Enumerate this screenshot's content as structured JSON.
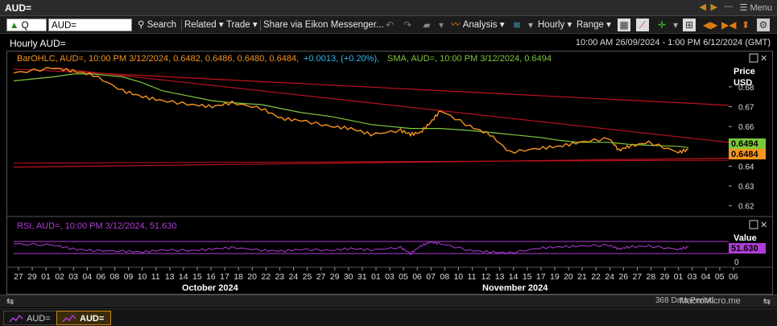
{
  "window": {
    "title": "AUD=",
    "menu_label": "Menu"
  },
  "toolbar": {
    "quote_label": "Q",
    "ric_value": "AUD=",
    "search_label": "Search",
    "related_label": "Related",
    "trade_label": "Trade",
    "share_label": "Share via Eikon Messenger...",
    "analysis_label": "Analysis",
    "interval_label": "Hourly",
    "range_label": "Range"
  },
  "header": {
    "chart_title": "Hourly AUD=",
    "time_range": "10:00 AM 26/09/2024 - 1:00 PM 6/12/2024 (GMT)"
  },
  "price_panel": {
    "legend_barohlc": "BarOHLC, AUD=, 10:00 PM 3/12/2024, 0.6482, 0.6486, 0.6480, 0.6484,",
    "legend_change": "+0.0013, (+0.20%),",
    "legend_sma": "SMA, AUD=, 10:00 PM 3/12/2024, 0.6494",
    "axis_title": "Price",
    "axis_unit": "USD",
    "y_ticks": [
      "0.68",
      "0.67",
      "0.66",
      "0.65",
      "0.64",
      "0.63",
      "0.62"
    ],
    "sma_badge": "0.6494",
    "price_badge": "0.6484",
    "colors": {
      "price": "#f7941d",
      "sma": "#7dc83a",
      "trendline": "#c0121d",
      "sma_badge_bg": "#7dc83a",
      "price_badge_bg": "#f7941d"
    }
  },
  "rsi_panel": {
    "legend": "RSI, AUD=, 10:00 PM 3/12/2024, 51.630",
    "axis_title": "Value",
    "value_badge": "51.630",
    "y_tick": "0",
    "colors": {
      "rsi": "#b03cd8",
      "band": "#b03cd8",
      "badge_bg": "#b03cd8"
    }
  },
  "x_axis": {
    "ticks": [
      "27",
      "29",
      "01",
      "02",
      "03",
      "04",
      "06",
      "08",
      "09",
      "10",
      "11",
      "13",
      "14",
      "15",
      "16",
      "17",
      "18",
      "20",
      "22",
      "23",
      "24",
      "25",
      "27",
      "29",
      "30",
      "31",
      "01",
      "03",
      "05",
      "06",
      "07",
      "08",
      "10",
      "11",
      "12",
      "13",
      "14",
      "15",
      "17",
      "19",
      "20",
      "21",
      "22",
      "24",
      "26",
      "27",
      "28",
      "29",
      "01",
      "03",
      "04",
      "05",
      "06"
    ],
    "month_labels": [
      "October 2024",
      "November 2024"
    ]
  },
  "status": {
    "data_period": "368 Data Period",
    "watermark": "MacroMicro.me"
  },
  "tabs": [
    {
      "label": "AUD=",
      "active": false
    },
    {
      "label": "AUD=",
      "active": true
    }
  ],
  "chart_data": {
    "type": "line",
    "title": "Hourly AUD=",
    "x": [
      "2024-09-26",
      "2024-09-30",
      "2024-10-02",
      "2024-10-04",
      "2024-10-07",
      "2024-10-09",
      "2024-10-11",
      "2024-10-14",
      "2024-10-16",
      "2024-10-18",
      "2024-10-21",
      "2024-10-23",
      "2024-10-25",
      "2024-10-28",
      "2024-10-30",
      "2024-11-01",
      "2024-11-04",
      "2024-11-05",
      "2024-11-06",
      "2024-11-07",
      "2024-11-08",
      "2024-11-11",
      "2024-11-13",
      "2024-11-15",
      "2024-11-18",
      "2024-11-20",
      "2024-11-22",
      "2024-11-25",
      "2024-11-26",
      "2024-11-27",
      "2024-11-29",
      "2024-12-02",
      "2024-12-03"
    ],
    "series": [
      {
        "name": "BarOHLC",
        "values": [
          0.687,
          0.6895,
          0.688,
          0.686,
          0.678,
          0.675,
          0.673,
          0.671,
          0.67,
          0.672,
          0.669,
          0.664,
          0.663,
          0.66,
          0.659,
          0.656,
          0.658,
          0.656,
          0.657,
          0.662,
          0.668,
          0.66,
          0.656,
          0.647,
          0.649,
          0.65,
          0.652,
          0.654,
          0.648,
          0.65,
          0.652,
          0.647,
          0.6484
        ]
      },
      {
        "name": "SMA",
        "values": [
          0.683,
          0.685,
          0.6865,
          0.6865,
          0.685,
          0.682,
          0.678,
          0.675,
          0.673,
          0.672,
          0.671,
          0.669,
          0.667,
          0.665,
          0.663,
          0.661,
          0.6595,
          0.659,
          0.659,
          0.659,
          0.659,
          0.658,
          0.657,
          0.656,
          0.6545,
          0.653,
          0.652,
          0.652,
          0.6515,
          0.651,
          0.6505,
          0.65,
          0.6494
        ]
      },
      {
        "name": "RSI",
        "values": [
          62,
          58,
          45,
          40,
          38,
          35,
          42,
          40,
          45,
          50,
          41,
          38,
          44,
          40,
          47,
          42,
          50,
          30,
          55,
          68,
          63,
          40,
          35,
          32,
          48,
          52,
          55,
          58,
          45,
          52,
          55,
          44,
          51.63
        ]
      }
    ],
    "ylim": [
      0.615,
      0.6905
    ],
    "ylabel": "Price USD"
  }
}
